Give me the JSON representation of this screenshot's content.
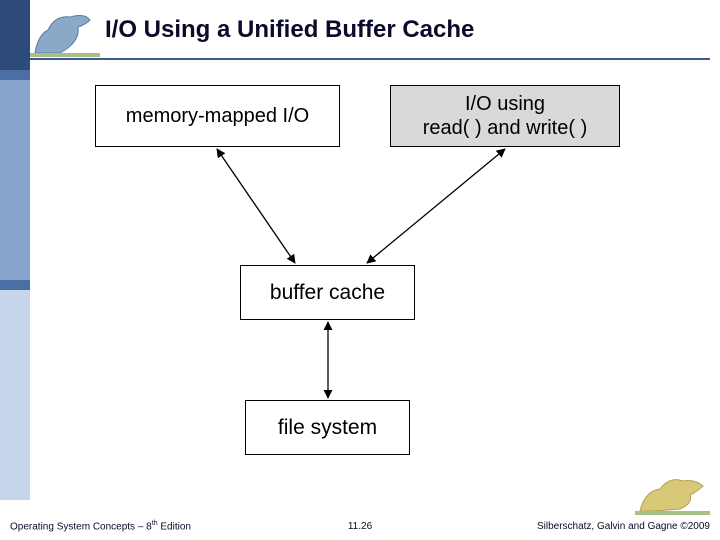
{
  "title": "I/O Using a Unified Buffer Cache",
  "boxes": {
    "memory_mapped": "memory-mapped I/O",
    "read_write_l1": "I/O using",
    "read_write_l2": "read( ) and write( )",
    "buffer_cache": "buffer cache",
    "file_system": "file system"
  },
  "footer": {
    "left_pre": "Operating System Concepts – 8",
    "left_sup": "th",
    "left_post": " Edition",
    "mid": "11.26",
    "right": "Silberschatz, Galvin and Gagne ©2009"
  },
  "mascots": {
    "tl": "dinosaur-blue",
    "br": "dinosaur-yellow"
  }
}
